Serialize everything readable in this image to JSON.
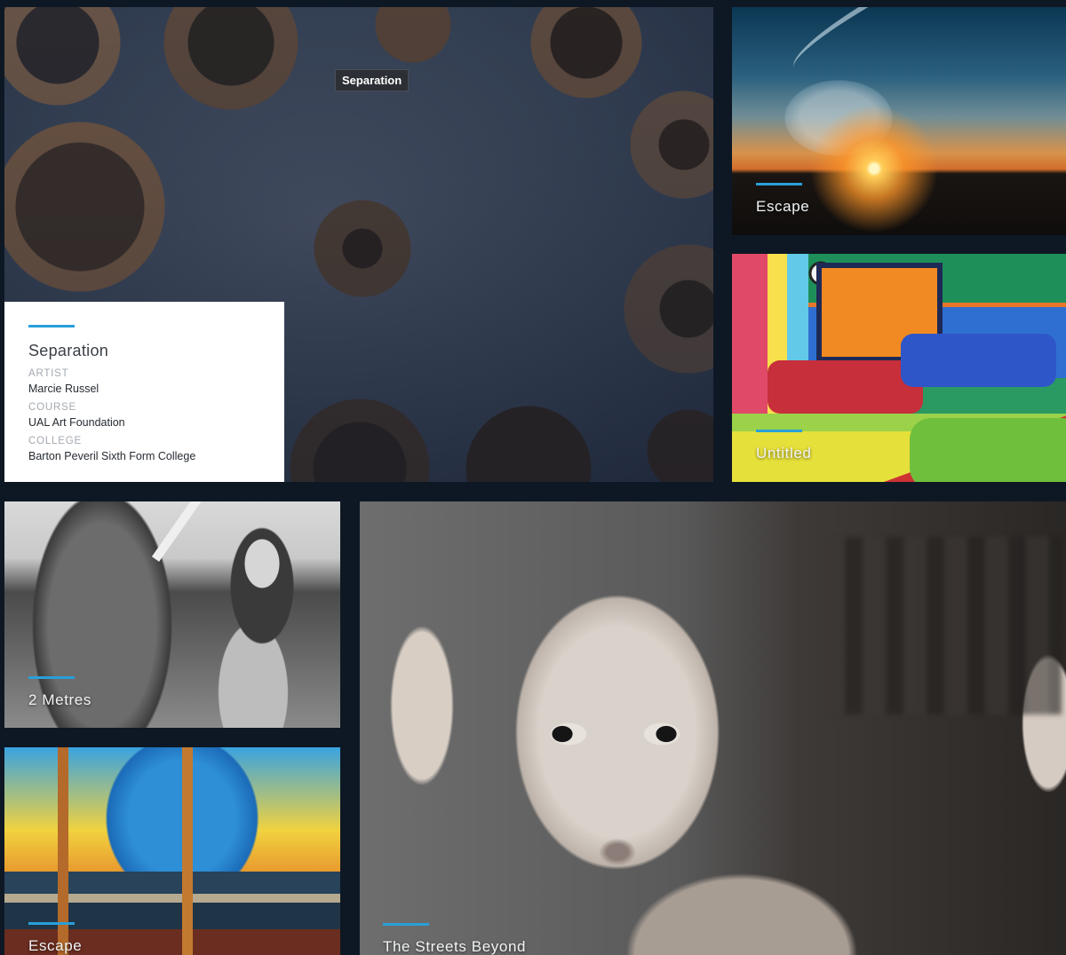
{
  "featured": {
    "title": "Separation",
    "tooltip": "Separation",
    "artist_label": "ARTIST",
    "artist": "Marcie Russel",
    "course_label": "COURSE",
    "course": "UAL Art Foundation",
    "college_label": "COLLEGE",
    "college": "Barton Peveril Sixth Form College"
  },
  "tiles": [
    {
      "title": "Escape"
    },
    {
      "title": "Untitled"
    },
    {
      "title": "2 Metres"
    },
    {
      "title": "Escape"
    },
    {
      "title": "The Streets Beyond"
    }
  ],
  "colors": {
    "accent": "#2a9fd8",
    "background": "#0e1824",
    "card": "#ffffff"
  }
}
